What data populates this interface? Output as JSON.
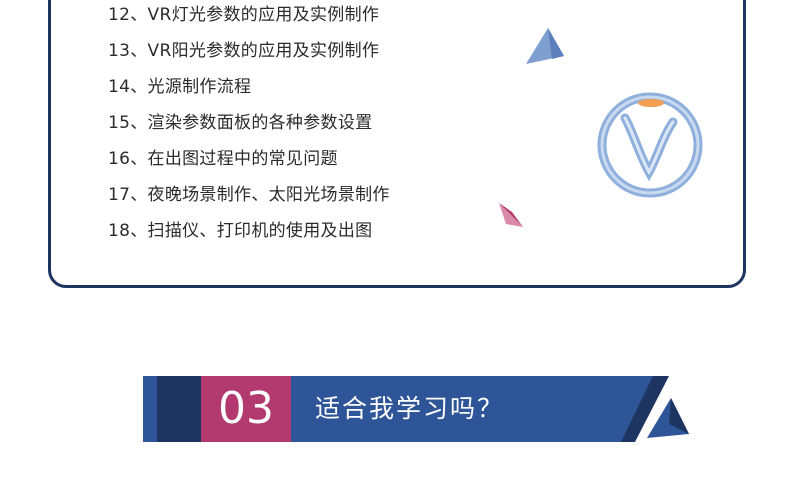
{
  "course_list": {
    "items": [
      "12、VR灯光参数的应用及实例制作",
      "13、VR阳光参数的应用及实例制作",
      "14、光源制作流程",
      "15、渲染参数面板的各种参数设置",
      "16、在出图过程中的常见问题",
      "17、夜晚场景制作、太阳光场景制作",
      "18、扫描仪、打印机的使用及出图"
    ]
  },
  "section_banner": {
    "number": "03",
    "title": "适合我学习吗？"
  },
  "colors": {
    "navy": "#1e3461",
    "banner_blue": "#2e5597",
    "magenta": "#b23a6e",
    "logo_blue": "#8fb0dc",
    "logo_orange": "#f0a050"
  },
  "icons": {
    "logo": "vray-logo-icon",
    "decor_blue": "triangle-decor-icon",
    "decor_pink": "triangle-decor-icon"
  }
}
